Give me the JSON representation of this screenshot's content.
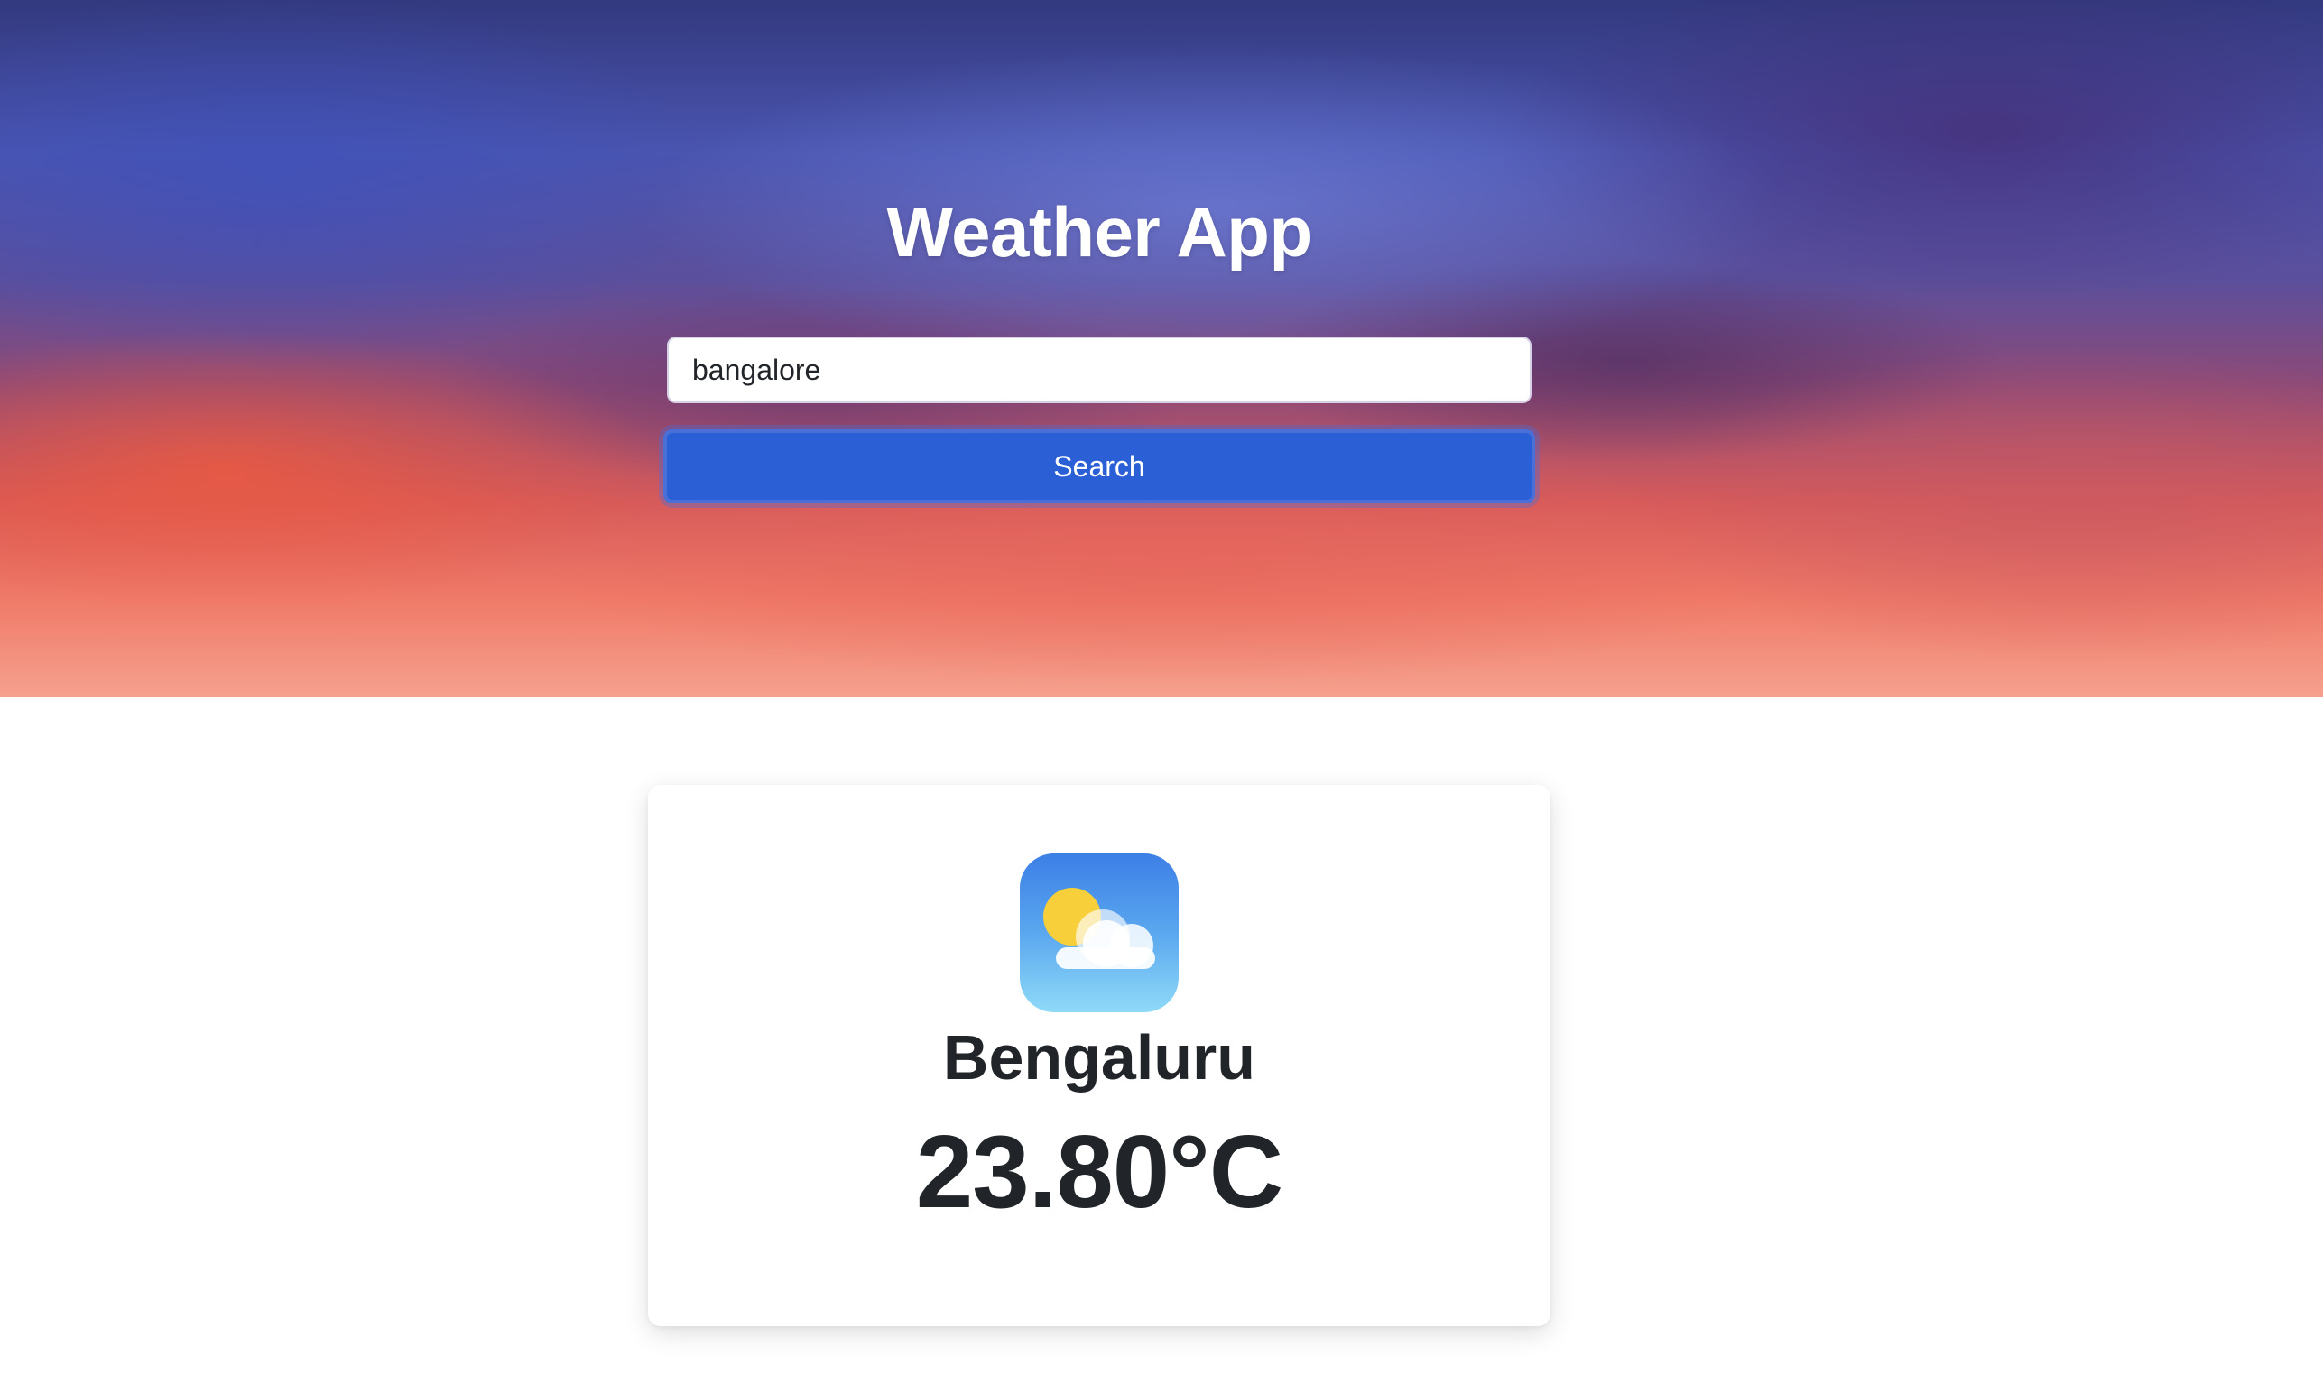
{
  "header": {
    "title": "Weather App"
  },
  "search": {
    "value": "bangalore",
    "button_label": "Search"
  },
  "result": {
    "icon": "partly-cloudy-icon",
    "city": "Bengaluru",
    "temperature": "23.80°C"
  },
  "colors": {
    "button": "#2a5fd6",
    "text": "#212529"
  }
}
